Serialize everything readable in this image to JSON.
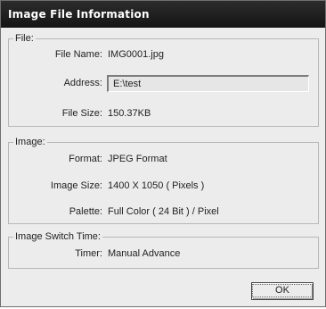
{
  "window": {
    "title": "Image File Information"
  },
  "file_group": {
    "legend": "File:",
    "file_name_label": "File Name:",
    "file_name_value": "IMG0001.jpg",
    "address_label": "Address:",
    "address_value": "E:\\test",
    "file_size_label": "File Size:",
    "file_size_value": "150.37KB"
  },
  "image_group": {
    "legend": "Image:",
    "format_label": "Format:",
    "format_value": "JPEG Format",
    "size_label": "Image Size:",
    "size_value": "1400 X 1050 ( Pixels )",
    "palette_label": "Palette:",
    "palette_value": "Full Color ( 24 Bit ) / Pixel"
  },
  "switch_group": {
    "legend": "Image Switch Time:",
    "timer_label": "Timer:",
    "timer_value": "Manual Advance"
  },
  "buttons": {
    "ok_label": "OK"
  }
}
